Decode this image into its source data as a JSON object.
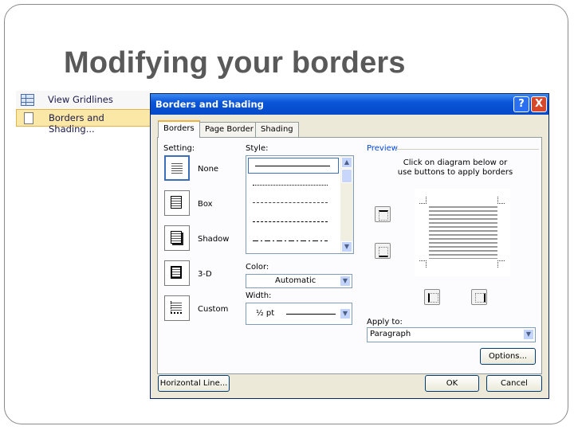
{
  "slide": {
    "title": "Modifying your borders"
  },
  "menu": {
    "items": [
      {
        "label": "View Gridlines",
        "icon": "gridlines-icon",
        "highlighted": false
      },
      {
        "label": "Borders and Shading...",
        "icon": "page-icon",
        "highlighted": true
      }
    ]
  },
  "dialog": {
    "title": "Borders and Shading",
    "help_label": "?",
    "close_label": "X",
    "tabs": [
      "Borders",
      "Page Border",
      "Shading"
    ],
    "active_tab": "Borders",
    "setting": {
      "label": "Setting:",
      "options": [
        "None",
        "Box",
        "Shadow",
        "3-D",
        "Custom"
      ],
      "selected": "None"
    },
    "style": {
      "label": "Style:"
    },
    "color": {
      "label": "Color:",
      "value": "Automatic"
    },
    "width": {
      "label": "Width:",
      "value": "½ pt"
    },
    "preview": {
      "label": "Preview",
      "instruction": "Click on diagram below or use buttons to apply borders"
    },
    "apply_to": {
      "label": "Apply to:",
      "value": "Paragraph"
    },
    "buttons": {
      "options": "Options...",
      "horizontal_line": "Horizontal Line...",
      "ok": "OK",
      "cancel": "Cancel"
    },
    "colors": {
      "titlebar": "#0a55d8",
      "dialog_bg": "#ece9d8",
      "tab_accent": "#f2b33b"
    }
  }
}
